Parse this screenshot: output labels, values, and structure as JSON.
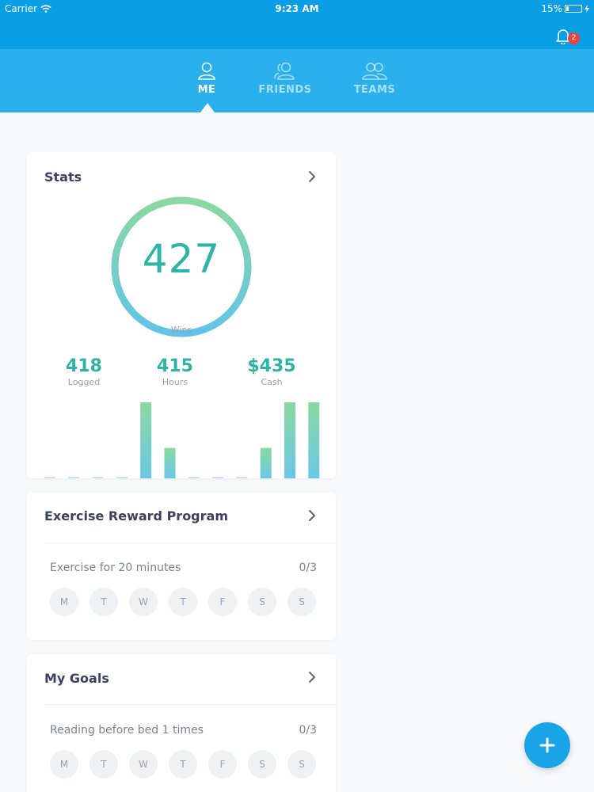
{
  "status_bar": {
    "carrier": "Carrier",
    "time": "9:23 AM",
    "battery": "15%"
  },
  "header": {
    "notification_count": "2",
    "tabs": [
      {
        "label": "ME",
        "icon": "person-icon",
        "active": true
      },
      {
        "label": "FRIENDS",
        "icon": "friends-icon",
        "active": false
      },
      {
        "label": "TEAMS",
        "icon": "teams-icon",
        "active": false
      }
    ]
  },
  "stats": {
    "title": "Stats",
    "wins_value": "427",
    "wins_label": "Wins",
    "metrics": [
      {
        "value": "418",
        "label": "Logged"
      },
      {
        "value": "415",
        "label": "Hours"
      },
      {
        "value": "$435",
        "label": "Cash"
      }
    ],
    "chart_levels": [
      0,
      0,
      0,
      0,
      1.0,
      0.4,
      0,
      0,
      0,
      0.4,
      1.0,
      1.0
    ]
  },
  "program": {
    "title": "Exercise Reward Program",
    "task": "Exercise for 20 minutes",
    "count": "0/3",
    "days": [
      "M",
      "T",
      "W",
      "T",
      "F",
      "S",
      "S"
    ]
  },
  "goals": {
    "title": "My Goals",
    "task": "Reading before bed 1 times",
    "count": "0/3",
    "days": [
      "M",
      "T",
      "W",
      "T",
      "F",
      "S",
      "S"
    ]
  },
  "colors": {
    "header": "#0a9ee4",
    "tabbar": "#2ab0ec",
    "accent": "#2db3a7",
    "ring_start": "#8ad9a0",
    "ring_end": "#62c3ea",
    "fab": "#1aa4e8"
  }
}
